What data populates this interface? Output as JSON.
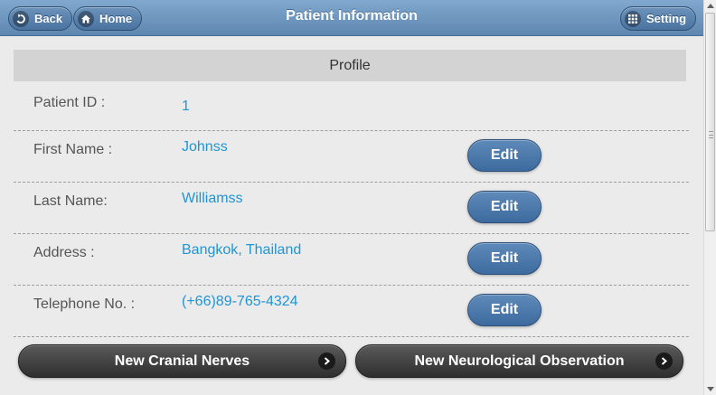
{
  "header": {
    "title": "Patient Information",
    "back_label": "Back",
    "home_label": "Home",
    "setting_label": "Setting"
  },
  "section": {
    "title": "Profile"
  },
  "fields": [
    {
      "label": "Patient ID :",
      "value": "1"
    },
    {
      "label": "First Name :",
      "value": "Johnss",
      "edit_label": "Edit"
    },
    {
      "label": "Last Name:",
      "value": "Williamss",
      "edit_label": "Edit"
    },
    {
      "label": "Address :",
      "value": "Bangkok, Thailand",
      "edit_label": "Edit"
    },
    {
      "label": "Telephone No. :",
      "value": "(+66)89-765-4324",
      "edit_label": "Edit"
    }
  ],
  "actions": {
    "cranial_label": "New Cranial Nerves",
    "neuro_label": "New Neurological Observation"
  },
  "icons": {
    "back": "back-arrow-icon",
    "home": "home-icon",
    "setting": "grid-icon",
    "forward": "chevron-right-icon"
  },
  "colors": {
    "header": "#6e96be",
    "value_text": "#1f95d4",
    "edit_button": "#4a77a8",
    "action_button": "#3a3a3a"
  }
}
